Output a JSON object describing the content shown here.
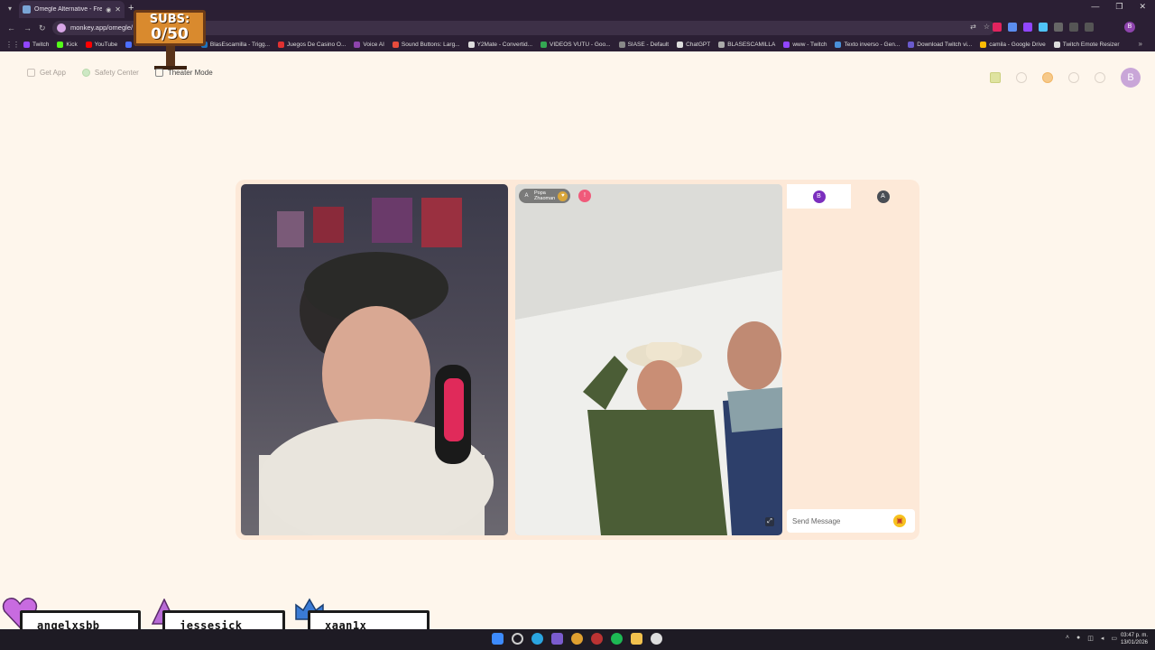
{
  "browser": {
    "tab": {
      "title": "Omegle Alternative - Free"
    },
    "address": "monkey.app/omegle/",
    "bookmarks": [
      {
        "label": "Twitch",
        "color": "#9146ff"
      },
      {
        "label": "Kick",
        "color": "#53fc18"
      },
      {
        "label": "YouTube",
        "color": "#ff0000"
      },
      {
        "label": "StreamElements - M...",
        "color": "#4c6fff"
      },
      {
        "label": "BlasEscamilla - Trigg...",
        "color": "#1e73be"
      },
      {
        "label": "Juegos De Casino O...",
        "color": "#e03131"
      },
      {
        "label": "Voice AI",
        "color": "#8e44ad"
      },
      {
        "label": "Sound Buttons: Larg...",
        "color": "#e74c3c"
      },
      {
        "label": "Y2Mate - Convertid...",
        "color": "#dddddd"
      },
      {
        "label": "VIDEOS VUTU - Goo...",
        "color": "#34a853"
      },
      {
        "label": "SIASE - Default",
        "color": "#888888"
      },
      {
        "label": "ChatGPT",
        "color": "#dddddd"
      },
      {
        "label": "BLASESCAMILLA",
        "color": "#aaaaaa"
      },
      {
        "label": "www - Twitch",
        "color": "#9146ff"
      },
      {
        "label": "Texto inverso - Gen...",
        "color": "#4a90d9"
      },
      {
        "label": "Download Twitch vi...",
        "color": "#6a5acd"
      },
      {
        "label": "camila - Google Drive",
        "color": "#fbbc04"
      },
      {
        "label": "Twitch Emote Resizer",
        "color": "#dddddd"
      }
    ]
  },
  "overlay": {
    "subs": {
      "label": "SUBS:",
      "count": "0/50"
    },
    "supporters": [
      {
        "name": "angelxsbb",
        "color": "#c86be0"
      },
      {
        "name": "jessesick",
        "color": "#b86bd6"
      },
      {
        "name": "xaan1x",
        "color": "#3a7bd5"
      }
    ]
  },
  "app": {
    "nav": {
      "get_app": "Get App",
      "safety_center": "Safety Center",
      "theater_mode": "Theater Mode"
    },
    "avatar_letter": "B",
    "remote_user": {
      "initial": "A",
      "name_line1": "Popa",
      "name_line2": "Zhaoman"
    },
    "chat": {
      "tab_self": "B",
      "tab_partner": "A",
      "placeholder": "Send Message"
    }
  },
  "taskbar": {
    "time": "03:47 p. m.",
    "date": "13/01/2026"
  },
  "colors": {
    "page_bg": "#fef6ec",
    "stage_bg": "#fde9d8",
    "chat_tab_self": "#7b2fbe",
    "chat_tab_partner": "#4a4e55",
    "gift": "#f7c21f",
    "report": "#f05a7a"
  }
}
